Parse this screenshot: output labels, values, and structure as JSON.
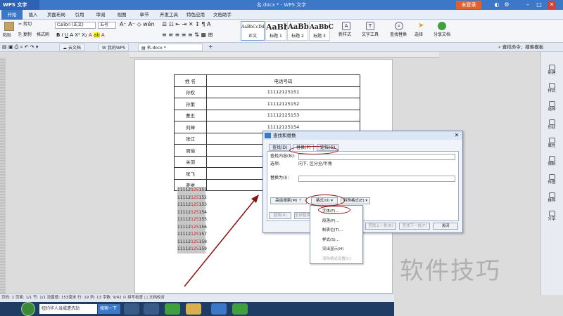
{
  "app": {
    "name": "WPS 文字",
    "doc_title": "名.docx * - WPS 文字",
    "login": "未登录"
  },
  "menu": [
    "开始",
    "插入",
    "页面布局",
    "引用",
    "审阅",
    "视图",
    "章节",
    "开发工具",
    "特色应用",
    "文档助手"
  ],
  "ribbon": {
    "paste": "粘贴",
    "cut": "剪切",
    "copy": "复制",
    "format_painter": "格式刷",
    "font": "Calibri (正文)",
    "size": "五号",
    "styles": [
      {
        "sample": "AaBbCcDd",
        "label": "正文"
      },
      {
        "sample": "AaBb",
        "label": "标题 1"
      },
      {
        "sample": "AaBb",
        "label": "标题 2"
      },
      {
        "sample": "AaBbC",
        "label": "标题 3"
      }
    ],
    "new_style": "新样式",
    "text_tools": "文字工具",
    "find_replace": "查找替换",
    "select": "选择",
    "share": "分享文档"
  },
  "doc_tabs": [
    "云文档",
    "我的WPS",
    "名.docx *"
  ],
  "find_cmd": "查找命令、搜索模板",
  "table": {
    "headers": [
      "姓  名",
      "电话号码"
    ],
    "rows": [
      [
        "孙权",
        "11112125151"
      ],
      [
        "孙策",
        "11112125152"
      ],
      [
        "曹丕",
        "11112125153"
      ],
      [
        "刘禅",
        "11112125154"
      ],
      [
        "张辽",
        ""
      ],
      [
        "周瑜",
        ""
      ],
      [
        "关羽",
        ""
      ],
      [
        "张飞",
        ""
      ],
      [
        "姜维",
        ""
      ]
    ]
  },
  "plain_numbers": [
    {
      "pre": "11112",
      "hl": "125",
      "post": "151"
    },
    {
      "pre": "11112",
      "hl": "125",
      "post": "152"
    },
    {
      "pre": "11112",
      "hl": "125",
      "post": "153"
    },
    {
      "pre": "11112",
      "hl": "125",
      "post": "154"
    },
    {
      "pre": "11112",
      "hl": "125",
      "post": "155"
    },
    {
      "pre": "11112",
      "hl": "125",
      "post": "156"
    },
    {
      "pre": "11112",
      "hl": "125",
      "post": "157"
    },
    {
      "pre": "11112",
      "hl": "125",
      "post": "158"
    },
    {
      "pre": "11112",
      "hl": "125",
      "post": "159"
    }
  ],
  "dialog": {
    "title": "查找和替换",
    "tabs": [
      "查找(D)",
      "替换(P)",
      "定位(G)"
    ],
    "find_label": "查找内容(N):",
    "options_label": "选项:",
    "options_value": "向下, 区分全/半角",
    "replace_label": "替换为(I):",
    "advanced": "高级搜索(M) ⇡",
    "format": "格式(O) ▾",
    "special": "特殊格式(E) ▾",
    "replace_btn": "替换(R)",
    "replace_all": "全部替换",
    "find_prev": "查找上一处(B)",
    "find_next": "查找下一处(F)",
    "close": "关闭"
  },
  "format_menu": [
    "字体(F)...",
    "段落(P)...",
    "制表位(T)...",
    "样式(S)...",
    "突出显示(H)",
    "清除格式设置(C)"
  ],
  "right_panel": [
    "新建",
    "样式",
    "选择",
    "形状",
    "属性",
    "限制",
    "传图",
    "推荐",
    "分享"
  ],
  "status": "页码: 1  页面: 1/1  节: 1/1  设置值: 153毫米  行: 19  列: 13  字数: 9/42  ☑ 拼写检查  □ 文档校对",
  "taskbar": {
    "search_text": "纽约华人当城遭洗劫",
    "search_btn": "搜索一下"
  },
  "watermark": "软件技巧"
}
